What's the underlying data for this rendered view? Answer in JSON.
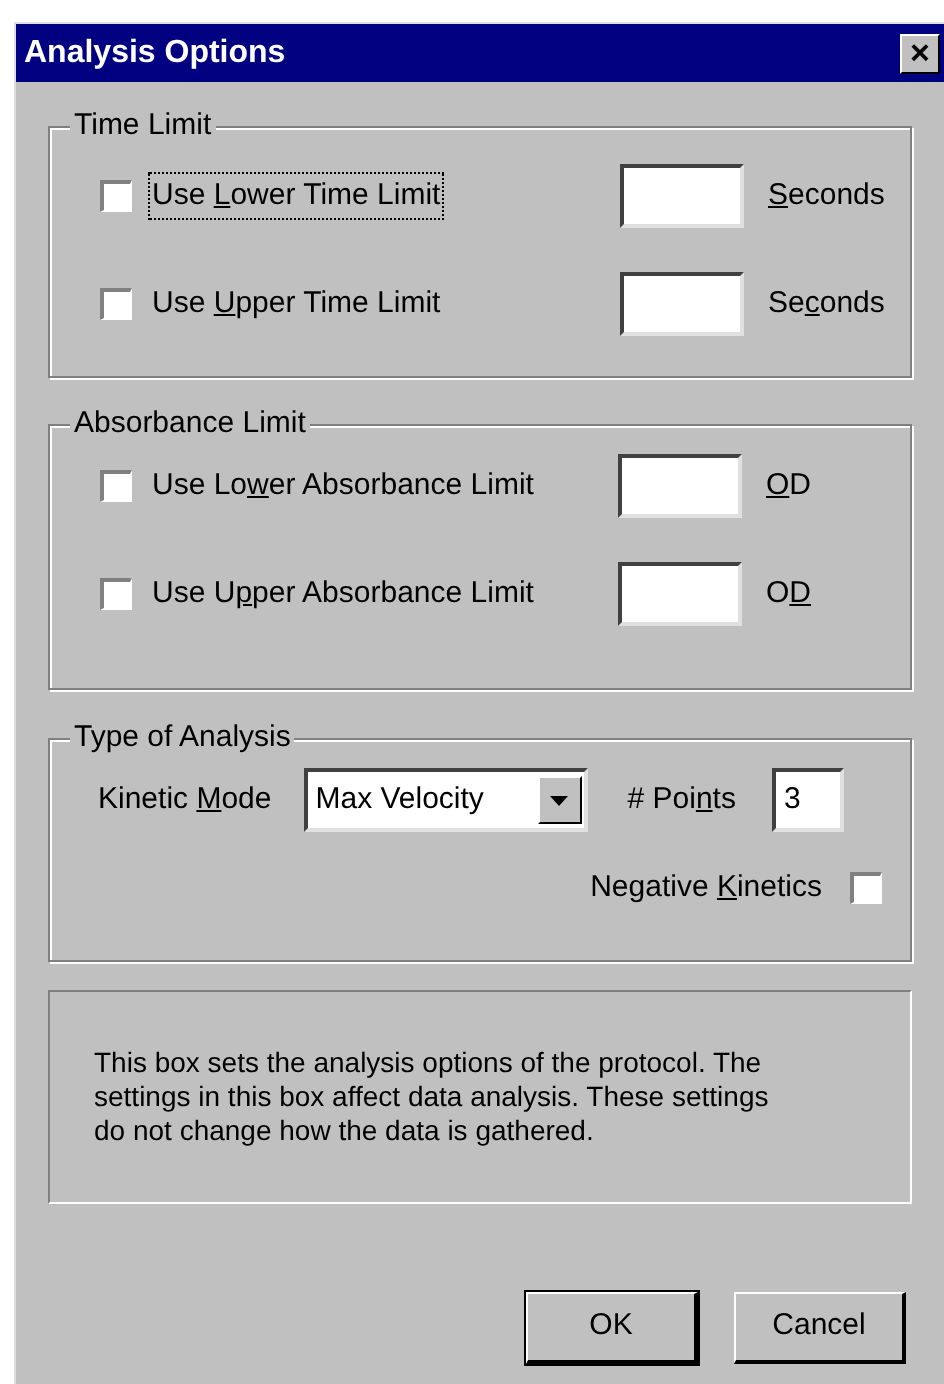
{
  "window": {
    "title": "Analysis Options",
    "close": "×"
  },
  "groups": [
    {
      "title": "Time Limit",
      "rows": [
        {
          "checked": false,
          "focused": true,
          "label": {
            "pre": "Use ",
            "key": "L",
            "post": "ower Time Limit"
          },
          "unit": {
            "key": "S",
            "post": "econds"
          }
        },
        {
          "checked": false,
          "focused": false,
          "label": {
            "pre": "Use ",
            "key": "U",
            "post": "pper Time Limit"
          },
          "unit": {
            "pre": "Se",
            "key": "c",
            "post": "onds"
          }
        }
      ]
    },
    {
      "title": "Absorbance Limit",
      "rows": [
        {
          "checked": false,
          "focused": false,
          "label": {
            "pre": "Use Lo",
            "key": "w",
            "post": "er Absorbance Limit"
          },
          "unit": {
            "key": "O",
            "post": "D"
          }
        },
        {
          "checked": false,
          "focused": false,
          "label": {
            "pre": "Use U",
            "key": "p",
            "post": "per Absorbance Limit"
          },
          "unit": {
            "pre": "O",
            "key": "D"
          }
        }
      ]
    }
  ],
  "analysis": {
    "title": "Type of Analysis",
    "mode_label": {
      "pre": "Kinetic ",
      "key": "M",
      "post": "ode"
    },
    "mode_value": "Max Velocity",
    "points_label": {
      "pre": "# Poi",
      "key": "n",
      "post": "ts"
    },
    "points_value": "3",
    "negative": {
      "label": {
        "pre": "Negative ",
        "key": "K",
        "post": "inetics"
      },
      "checked": false
    }
  },
  "info": "This box sets the analysis options of the protocol. The settings in this box affect data analysis. These settings do not change how the data is gathered.",
  "buttons": [
    {
      "label": "OK",
      "default": true
    },
    {
      "label": "Cancel",
      "default": false
    }
  ]
}
